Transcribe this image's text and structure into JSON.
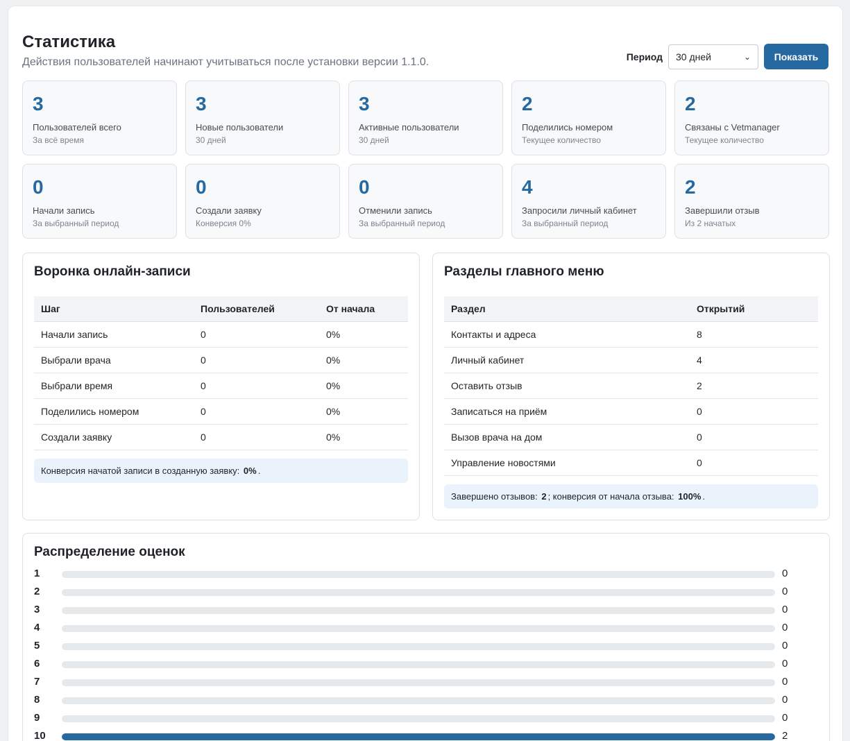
{
  "header": {
    "title": "Статистика",
    "subtitle": "Действия пользователей начинают учитываться после установки версии 1.1.0.",
    "period_label": "Период",
    "period_value": "30 дней",
    "show_button": "Показать"
  },
  "cards": [
    {
      "value": "3",
      "label": "Пользователей всего",
      "sub": "За всё время"
    },
    {
      "value": "3",
      "label": "Новые пользователи",
      "sub": "30 дней"
    },
    {
      "value": "3",
      "label": "Активные пользователи",
      "sub": "30 дней"
    },
    {
      "value": "2",
      "label": "Поделились номером",
      "sub": "Текущее количество"
    },
    {
      "value": "2",
      "label": "Связаны с Vetmanager",
      "sub": "Текущее количество"
    },
    {
      "value": "0",
      "label": "Начали запись",
      "sub": "За выбранный период"
    },
    {
      "value": "0",
      "label": "Создали заявку",
      "sub": "Конверсия 0%"
    },
    {
      "value": "0",
      "label": "Отменили запись",
      "sub": "За выбранный период"
    },
    {
      "value": "4",
      "label": "Запросили личный кабинет",
      "sub": "За выбранный период"
    },
    {
      "value": "2",
      "label": "Завершили отзыв",
      "sub": "Из 2 начатых"
    }
  ],
  "funnel": {
    "title": "Воронка онлайн-записи",
    "headers": [
      "Шаг",
      "Пользователей",
      "От начала"
    ],
    "rows": [
      [
        "Начали запись",
        "0",
        "0%"
      ],
      [
        "Выбрали врача",
        "0",
        "0%"
      ],
      [
        "Выбрали время",
        "0",
        "0%"
      ],
      [
        "Поделились номером",
        "0",
        "0%"
      ],
      [
        "Создали заявку",
        "0",
        "0%"
      ]
    ],
    "note_text": "Конверсия начатой записи в созданную заявку:",
    "note_value": "0%",
    "note_end": "."
  },
  "menu": {
    "title": "Разделы главного меню",
    "headers": [
      "Раздел",
      "Открытий"
    ],
    "rows": [
      [
        "Контакты и адреса",
        "8"
      ],
      [
        "Личный кабинет",
        "4"
      ],
      [
        "Оставить отзыв",
        "2"
      ],
      [
        "Записаться на приём",
        "0"
      ],
      [
        "Вызов врача на дом",
        "0"
      ],
      [
        "Управление новостями",
        "0"
      ]
    ],
    "note_a": "Завершено отзывов:",
    "note_a_value": "2",
    "note_b": "; конверсия от начала отзыва:",
    "note_b_value": "100%",
    "note_end": "."
  },
  "ratings": {
    "title": "Распределение оценок",
    "rows": [
      {
        "score": "1",
        "count": "0",
        "fraction": 0
      },
      {
        "score": "2",
        "count": "0",
        "fraction": 0
      },
      {
        "score": "3",
        "count": "0",
        "fraction": 0
      },
      {
        "score": "4",
        "count": "0",
        "fraction": 0
      },
      {
        "score": "5",
        "count": "0",
        "fraction": 0
      },
      {
        "score": "6",
        "count": "0",
        "fraction": 0
      },
      {
        "score": "7",
        "count": "0",
        "fraction": 0
      },
      {
        "score": "8",
        "count": "0",
        "fraction": 0
      },
      {
        "score": "9",
        "count": "0",
        "fraction": 0
      },
      {
        "score": "10",
        "count": "2",
        "fraction": 1
      }
    ]
  },
  "colors": {
    "accent": "#2669a0",
    "note_bg": "#eaf3fb"
  }
}
